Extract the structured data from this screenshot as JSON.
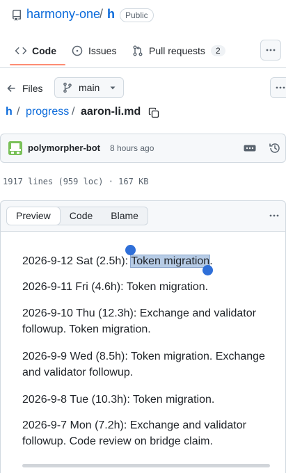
{
  "repo": {
    "owner": "harmony-one",
    "separator": "/",
    "name": "h",
    "visibility": "Public"
  },
  "nav": {
    "tabs": [
      {
        "label": "Code",
        "icon": "code-icon"
      },
      {
        "label": "Issues",
        "icon": "issue-icon"
      },
      {
        "label": "Pull requests",
        "icon": "pull-request-icon",
        "count": "2"
      }
    ]
  },
  "toolbar": {
    "files_label": "Files",
    "branch": "main"
  },
  "breadcrumb": {
    "root": "h",
    "sep": "/",
    "folder": "progress",
    "file": "aaron-li.md"
  },
  "commit": {
    "author": "polymorpher-bot",
    "time": "8 hours ago"
  },
  "file_meta": "1917 lines (959 loc) · 167 KB",
  "viewer": {
    "modes": [
      "Preview",
      "Code",
      "Blame"
    ],
    "active_mode": "Preview"
  },
  "entries": [
    {
      "prefix": "2026-9-12 Sat (2.5h): ",
      "selected": "Token migration",
      "suffix": "."
    },
    {
      "text": "2026-9-11 Fri (4.6h): Token migration."
    },
    {
      "text": "2026-9-10 Thu (12.3h): Exchange and validator followup. Token migration."
    },
    {
      "text": "2026-9-9 Wed (8.5h): Token migration. Exchange and validator followup."
    },
    {
      "text": "2026-9-8 Tue (10.3h): Token migration."
    },
    {
      "text": "2026-9-7 Mon (7.2h): Exchange and validator followup. Code review on bridge claim."
    }
  ],
  "colors": {
    "link": "#0969da",
    "tab_underline": "#fd8c73",
    "selection": "#b6cbe5",
    "handle": "#2f6fd8"
  }
}
